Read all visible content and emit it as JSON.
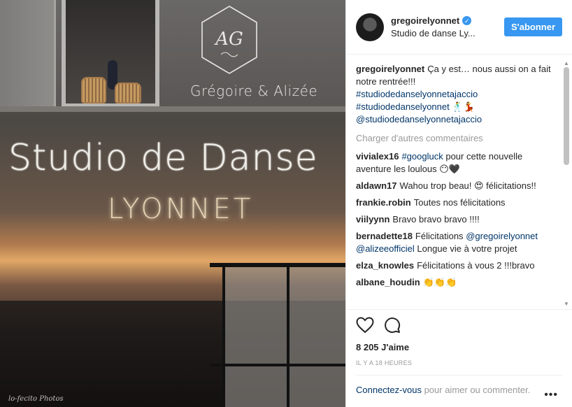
{
  "photo": {
    "logo_initials": "AG",
    "logo_name": "Grégoire & Alizée",
    "sign_main": "Studio de Danse",
    "sign_sub": "LYONNET",
    "watermark": "lo-fecito Photos"
  },
  "header": {
    "username": "gregoirelyonnet",
    "verified_icon": "verified-badge-icon",
    "location": "Studio de danse Ly...",
    "follow_label": "S'abonner"
  },
  "caption": {
    "username": "gregoirelyonnet",
    "text": "Ça y est… nous aussi on a fait notre rentrée!!!",
    "tags": [
      "#studiodedanselyonnetajaccio",
      "#studiodedanselyonnet 🕺💃",
      "@studiodedanselyonnetajaccio"
    ]
  },
  "load_more": "Charger d'autres commentaires",
  "comments": [
    {
      "user": "vivialex16",
      "pre": "",
      "mention": "#googluck",
      "text": " pour cette nouvelle aventure les loulous 😶🖤"
    },
    {
      "user": "aldawn17",
      "pre": "Wahou trop beau! 😍 félicitations!!",
      "mention": "",
      "text": ""
    },
    {
      "user": "frankie.robin",
      "pre": "Toutes nos félicitations",
      "mention": "",
      "text": ""
    },
    {
      "user": "viilyynn",
      "pre": "Bravo bravo bravo !!!!",
      "mention": "",
      "text": ""
    },
    {
      "user": "bernadette18",
      "pre": "Félicitations",
      "mention": "@gregoirelyonnet @alizeeofficiel",
      "text": " Longue vie à votre projet"
    },
    {
      "user": "elza_knowles",
      "pre": "Félicitations à vous 2 !!!bravo",
      "mention": "",
      "text": ""
    },
    {
      "user": "albane_houdin",
      "pre": "👏👏👏",
      "mention": "",
      "text": ""
    }
  ],
  "footer": {
    "like_icon": "heart-outline-icon",
    "comment_icon": "comment-bubble-icon",
    "likes": "8 205 J'aime",
    "time": "IL Y A 18 HEURES",
    "login_link": "Connectez-vous",
    "login_text": " pour aimer ou commenter.",
    "more_icon": "more-options-icon",
    "more_glyph": "•••"
  },
  "colors": {
    "accent": "#3897f0",
    "link": "#003569",
    "muted": "#999999"
  }
}
